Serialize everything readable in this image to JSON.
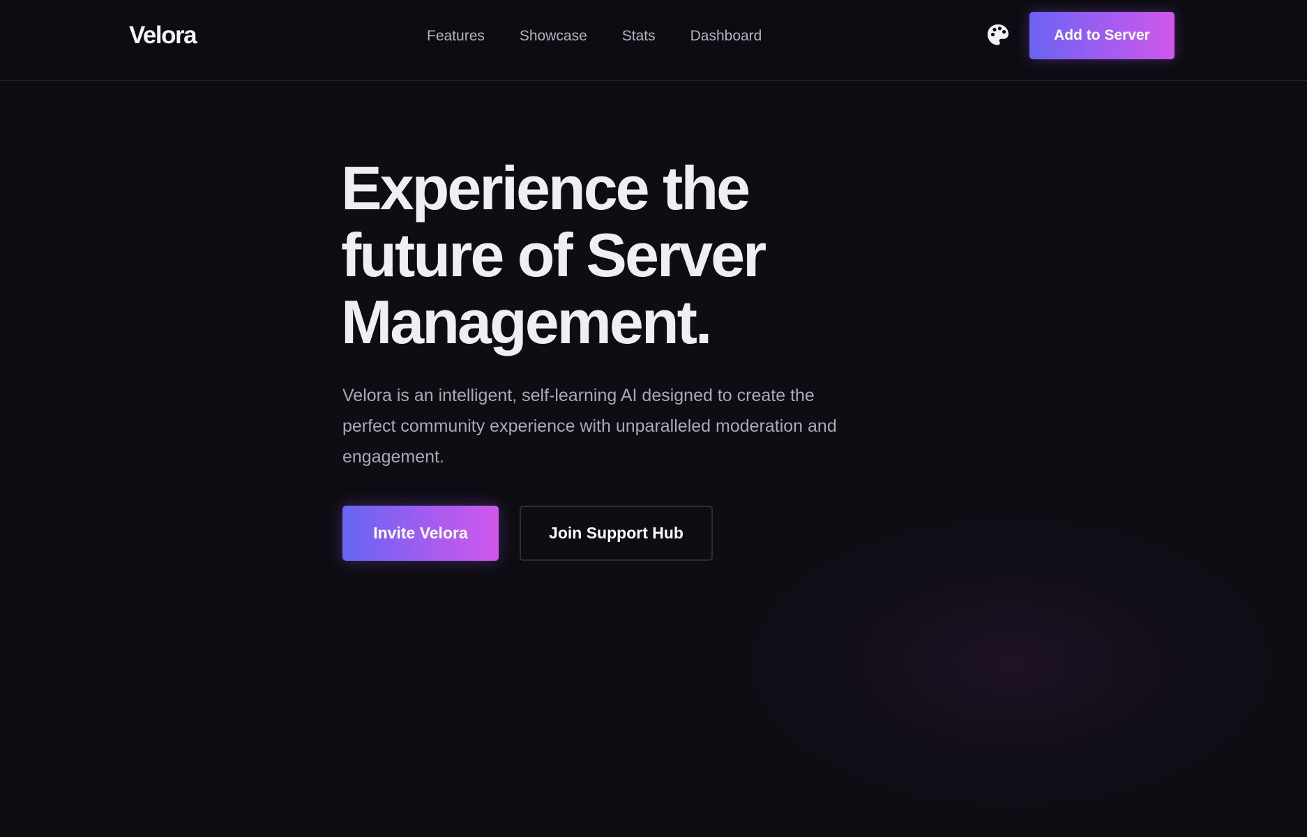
{
  "header": {
    "logo": "Velora",
    "nav": [
      {
        "label": "Features"
      },
      {
        "label": "Showcase"
      },
      {
        "label": "Stats"
      },
      {
        "label": "Dashboard"
      }
    ],
    "theme_icon": "palette-icon",
    "cta_label": "Add to Server"
  },
  "hero": {
    "title_lines": [
      "Experience the",
      "future of Server",
      "Management."
    ],
    "description": "Velora is an intelligent, self-learning AI designed to create the perfect community experience with unparalleled moderation and engagement.",
    "primary_button": "Invite Velora",
    "secondary_button": "Join Support Hub"
  },
  "colors": {
    "background": "#0e0d13",
    "accent_start": "#6b63f3",
    "accent_end": "#cf58ea",
    "text_primary": "#efeff3",
    "text_muted": "#a9a9b8"
  }
}
